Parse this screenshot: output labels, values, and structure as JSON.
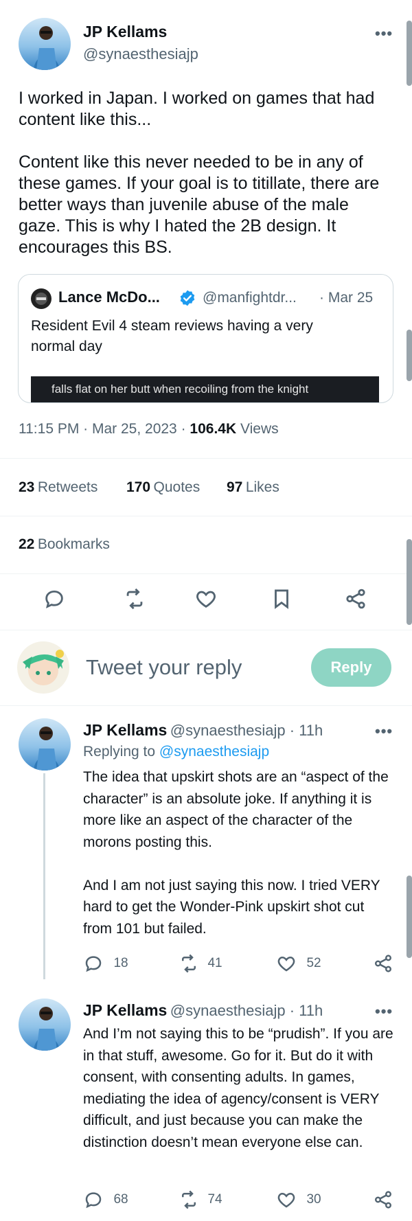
{
  "tweet": {
    "author": "JP Kellams",
    "handle": "@synaesthesiajp",
    "more": "•••",
    "text": "I worked in Japan. I worked on games that had content like this...\n\nContent like this never needed to be in any of these games. If your goal is to titillate, there are better ways than juvenile abuse of the male gaze. This is why I hated the 2B design. It encourages this BS.",
    "quote": {
      "author": "Lance McDo...",
      "handle": "@manfightdr...",
      "date": "· Mar 25",
      "text": "Resident Evil 4 steam reviews having a very normal day",
      "image_caption": "falls flat on her butt when recoiling from the knight"
    },
    "timestamp": "11:15 PM · Mar 25, 2023 ·",
    "views_count": "106.4K",
    "views_label": "Views",
    "stats": {
      "retweets_count": "23",
      "retweets_label": "Retweets",
      "quotes_count": "170",
      "quotes_label": "Quotes",
      "likes_count": "97",
      "likes_label": "Likes",
      "bookmarks_count": "22",
      "bookmarks_label": "Bookmarks"
    }
  },
  "composer": {
    "placeholder": "Tweet your reply",
    "button_label": "Reply"
  },
  "replies": [
    {
      "author": "JP Kellams",
      "handle_time": "@synaesthesiajp · 11h",
      "replying_prefix": "Replying to",
      "replying_handle": "@synaesthesiajp",
      "text": "The idea that upskirt shots are an “aspect of the character” is an absolute joke. If anything it is more like an aspect of the character of the morons posting this.\n\nAnd I am not just saying this now. I tried VERY hard to get the Wonder-Pink upskirt shot cut from 101 but failed.",
      "replies": "18",
      "retweets": "41",
      "likes": "52"
    },
    {
      "author": "JP Kellams",
      "handle_time": "@synaesthesiajp · 11h",
      "text": "And I’m not saying this to be “prudish”. If you are in that stuff, awesome. Go for it. But do it with consent, with consenting adults. In games, mediating the idea of agency/consent is VERY difficult, and just because you can make the distinction doesn’t mean everyone else can.",
      "replies": "68",
      "retweets": "74",
      "likes": "30"
    }
  ],
  "colors": {
    "accent": "#1d9bf0",
    "reply_button": "#8ed5c4",
    "text": "#0f1419",
    "muted": "#536471"
  }
}
